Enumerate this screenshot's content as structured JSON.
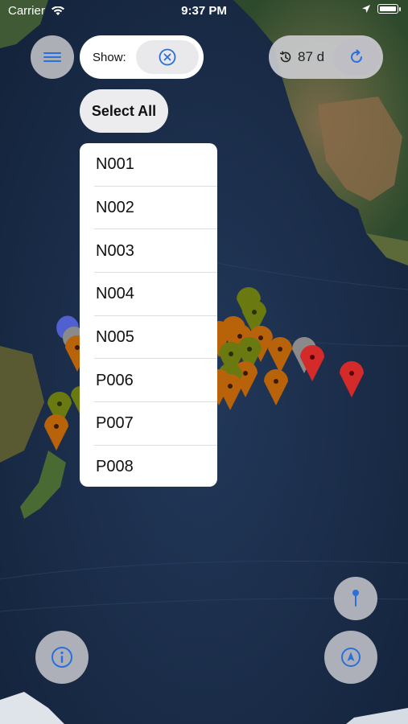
{
  "status_bar": {
    "carrier": "Carrier",
    "time": "9:37 PM"
  },
  "filter": {
    "show_label": "Show:",
    "clear_icon": "xmark-circle-icon",
    "select_all_label": "Select All"
  },
  "history": {
    "icon": "clock-history-icon",
    "days_label": "87 d",
    "refresh_icon": "refresh-icon"
  },
  "station_list": {
    "items": [
      "N001",
      "N002",
      "N003",
      "N004",
      "N005",
      "P006",
      "P007",
      "P008"
    ]
  },
  "buttons": {
    "menu_icon": "hamburger-menu-icon",
    "info_icon": "info-icon",
    "pin_icon": "pin-icon",
    "locate_icon": "location-arrow-icon"
  },
  "colors": {
    "accent": "#2a6fdb",
    "marker_orange": "#b8620a",
    "marker_olive": "#6a7a10",
    "marker_red": "#d42a2a",
    "marker_gray": "#8a8a8a",
    "marker_blue": "#5060d0"
  }
}
